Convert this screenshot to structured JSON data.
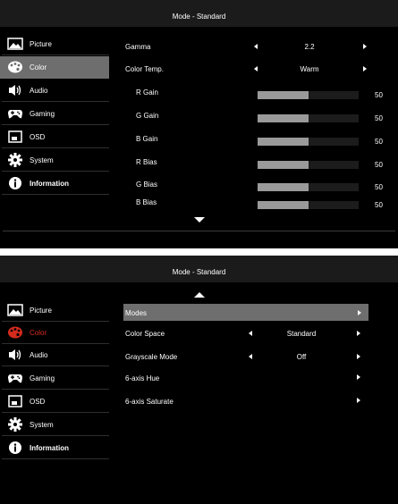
{
  "colors": {
    "selected_bg": "#6e6e6e",
    "active_red": "#d52b1e",
    "bar_fill": "#9a9a9a"
  },
  "sidebar": {
    "items": [
      {
        "label": "Picture",
        "icon": "picture-icon"
      },
      {
        "label": "Color",
        "icon": "palette-icon"
      },
      {
        "label": "Audio",
        "icon": "speaker-icon"
      },
      {
        "label": "Gaming",
        "icon": "gamepad-icon"
      },
      {
        "label": "OSD",
        "icon": "osd-icon"
      },
      {
        "label": "System",
        "icon": "gear-icon"
      },
      {
        "label": "Information",
        "icon": "info-icon"
      }
    ]
  },
  "panel1": {
    "title": "Mode - Standard",
    "gamma": {
      "label": "Gamma",
      "value": "2.2"
    },
    "color_temp": {
      "label": "Color Temp.",
      "value": "Warm"
    },
    "sliders": [
      {
        "label": "R Gain",
        "value": 50,
        "fill": 0.5
      },
      {
        "label": "G Gain",
        "value": 50,
        "fill": 0.5
      },
      {
        "label": "B Gain",
        "value": 50,
        "fill": 0.5
      },
      {
        "label": "R Bias",
        "value": 50,
        "fill": 0.5
      },
      {
        "label": "G Bias",
        "value": 50,
        "fill": 0.5
      },
      {
        "label": "B Bias",
        "value": 50,
        "fill": 0.5
      }
    ]
  },
  "panel2": {
    "title": "Mode - Standard",
    "modes": {
      "label": "Modes"
    },
    "color_space": {
      "label": "Color Space",
      "value": "Standard"
    },
    "grayscale": {
      "label": "Grayscale Mode",
      "value": "Off"
    },
    "hue": {
      "label": "6-axis Hue"
    },
    "saturate": {
      "label": "6-axis Saturate"
    }
  }
}
